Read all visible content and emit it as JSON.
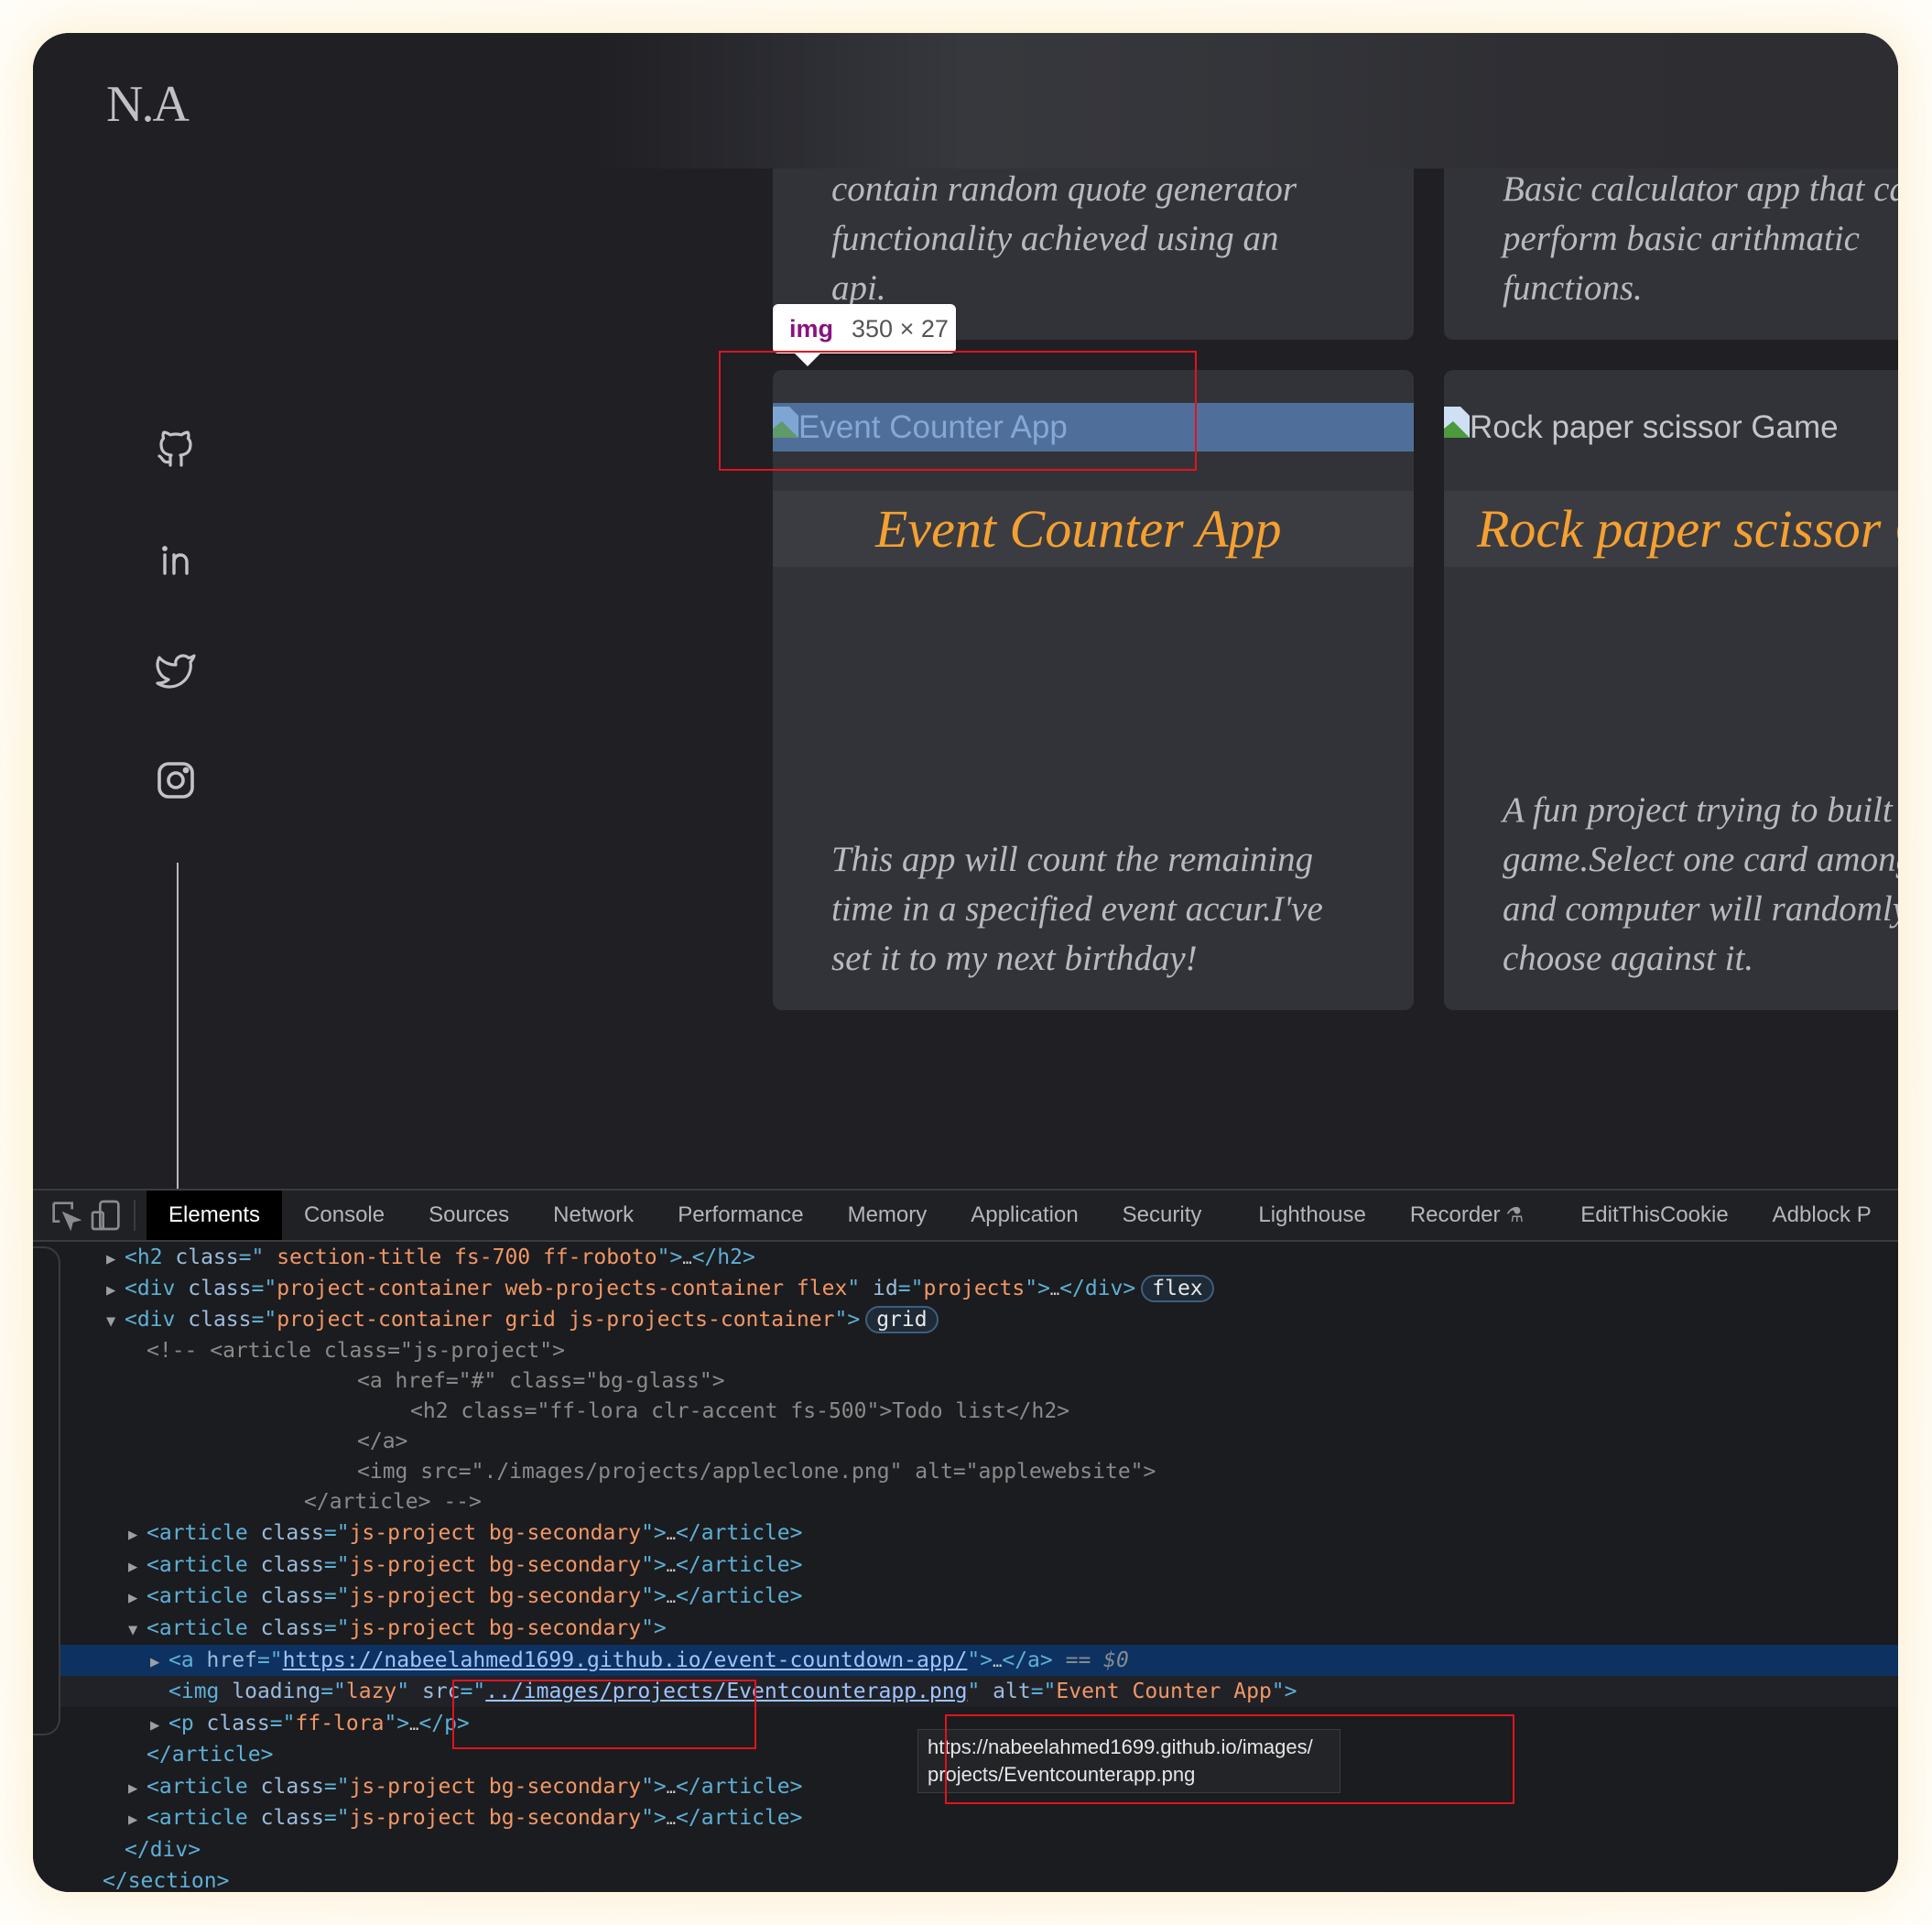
{
  "site": {
    "logo": "N.A",
    "socials": [
      {
        "name": "github-icon"
      },
      {
        "name": "linkedin-icon"
      },
      {
        "name": "twitter-icon"
      },
      {
        "name": "instagram-icon"
      }
    ],
    "cards_top": [
      {
        "description": "contain random quote generator\nfunctionality achieved using an\napi."
      },
      {
        "description": "Basic calculator app that can\nperform basic arithmatic\nfunctions."
      }
    ],
    "cards": [
      {
        "img_alt": "Event Counter App",
        "title": "Event Counter App",
        "description": "This app will count the remaining\ntime in a specified event accur.I've\nset it to my next birthday!"
      },
      {
        "img_alt": "Rock paper scissor Game",
        "title": "Rock paper scissor Game",
        "description": "A fun project trying to built\ngame.Select one card among\nand computer will randomly\nchoose against it."
      }
    ],
    "inspect_tooltip": {
      "tag": "img",
      "size": "350 × 27"
    },
    "accent_color": "#f5a030"
  },
  "devtools": {
    "tabs": [
      "Elements",
      "Console",
      "Sources",
      "Network",
      "Performance",
      "Memory",
      "Application",
      "Security",
      "Lighthouse",
      "Recorder",
      "EditThisCookie",
      "Adblock P"
    ],
    "active_tab": "Elements",
    "tree": {
      "h2_class": " section-title fs-700 ff-roboto",
      "div1_class": "project-container web-projects-container flex",
      "div1_id": "projects",
      "badge_flex": "flex",
      "div2_class": "project-container grid js-projects-container",
      "badge_grid": "grid",
      "comment": [
        "<!-- <article class=\"js-project\">",
        "<a href=\"#\" class=\"bg-glass\">",
        "<h2 class=\"ff-lora clr-accent fs-500\">Todo list</h2>",
        "</a>",
        "<img src=\"./images/projects/appleclone.png\" alt=\"applewebsite\">",
        "</article> -->"
      ],
      "article_class": "js-project bg-secondary",
      "a_href": "https://nabeelahmed1699.github.io/event-countdown-app/",
      "selected_marker": "== $0",
      "img_loading": "lazy",
      "img_src": "../images/projects/Eventcounterapp.png",
      "img_alt": "Event Counter App",
      "p_class": "ff-lora"
    },
    "url_tooltip": "https://nabeelahmed1699.github.io/images/\nprojects/Eventcounterapp.png"
  }
}
